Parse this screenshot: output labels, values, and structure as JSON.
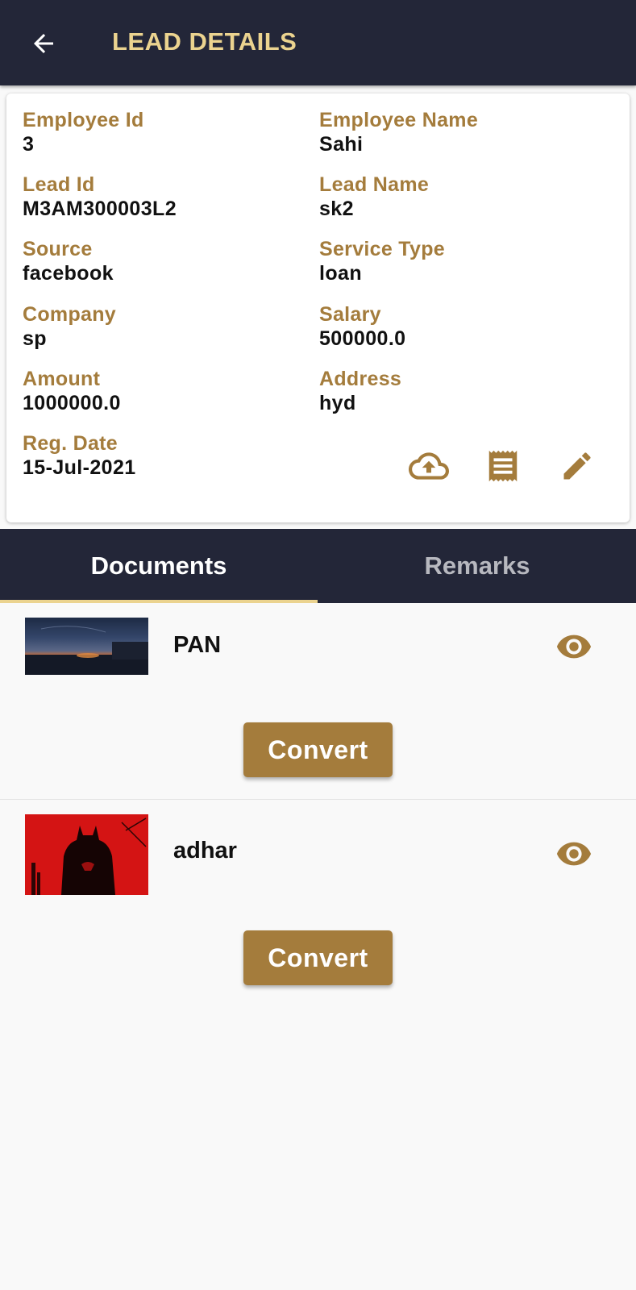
{
  "appbar": {
    "back_icon": "arrow-left-icon",
    "title": "LEAD DETAILS"
  },
  "lead": {
    "employee_id_label": "Employee Id",
    "employee_id": "3",
    "employee_name_label": "Employee Name",
    "employee_name": "Sahi",
    "lead_id_label": "Lead Id",
    "lead_id": "M3AM300003L2",
    "lead_name_label": "Lead Name",
    "lead_name": "sk2",
    "source_label": "Source",
    "source": "facebook",
    "service_type_label": "Service Type",
    "service_type": "loan",
    "company_label": "Company",
    "company": "sp",
    "salary_label": "Salary",
    "salary": "500000.0",
    "amount_label": "Amount",
    "amount": "1000000.0",
    "address_label": "Address",
    "address": "hyd",
    "reg_date_label": "Reg. Date",
    "reg_date": "15-Jul-2021",
    "actions": [
      "upload-cloud-icon",
      "receipt-icon",
      "edit-pencil-icon"
    ]
  },
  "tabs": [
    {
      "label": "Documents",
      "active": true
    },
    {
      "label": "Remarks",
      "active": false
    }
  ],
  "documents": [
    {
      "name": "PAN",
      "thumbnail": "night-sky-photo",
      "view_icon": "eye-icon",
      "button": "Convert"
    },
    {
      "name": "adhar",
      "thumbnail": "batman-red-poster",
      "view_icon": "eye-icon",
      "button": "Convert"
    }
  ],
  "colors": {
    "appbar_bg": "#232638",
    "title_gold": "#ebd38f",
    "label_brown": "#a47c3c",
    "button_brown": "#a47c3c",
    "page_bg": "#f9f9f9"
  }
}
